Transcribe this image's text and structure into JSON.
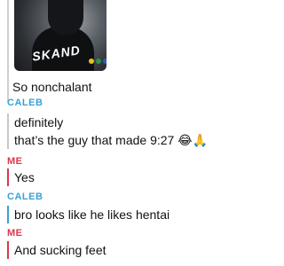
{
  "thread": {
    "photo_message": {
      "graffiti_text": "SKAND",
      "caption": "So nonchalant"
    },
    "messages": [
      {
        "sender": "CALEB",
        "lines": [
          "definitely",
          "that’s the guy that made 9:27 😂🙏"
        ]
      },
      {
        "sender": "ME",
        "lines": [
          "Yes"
        ]
      },
      {
        "sender": "CALEB",
        "lines": [
          "bro looks like he likes hentai"
        ]
      },
      {
        "sender": "ME",
        "lines": [
          "And sucking feet"
        ]
      }
    ]
  },
  "colors": {
    "caleb": "#3aa0d8",
    "me": "#e0344b",
    "text": "#111111"
  }
}
